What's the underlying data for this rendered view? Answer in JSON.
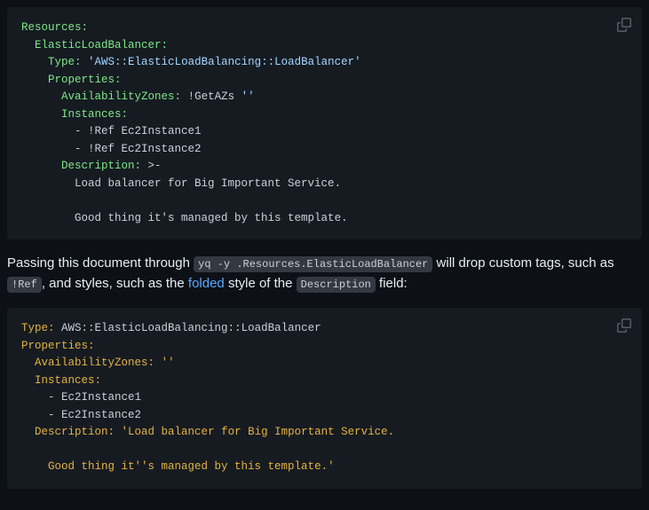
{
  "code1": {
    "l1_key": "Resources:",
    "l2_key": "ElasticLoadBalancer:",
    "l3_key": "Type:",
    "l3_val": "'AWS::ElasticLoadBalancing::LoadBalancer'",
    "l4_key": "Properties:",
    "l5_key": "AvailabilityZones:",
    "l5_tag": "!GetAZs",
    "l5_val": "''",
    "l6_key": "Instances:",
    "l7_tag": "!Ref",
    "l7_val": "Ec2Instance1",
    "l8_tag": "!Ref",
    "l8_val": "Ec2Instance2",
    "l9_key": "Description:",
    "l9_op": ">-",
    "l10": "Load balancer for Big Important Service.",
    "l11": "",
    "l12": "Good thing it's managed by this template."
  },
  "para": {
    "t1": "Passing this document through ",
    "cmd": "yq -y .Resources.ElasticLoadBalancer",
    "t2": " will drop custom tags, such as ",
    "ref": "!Ref",
    "t3": ", and styles, such as the ",
    "link": "folded",
    "t4": " style of the ",
    "desc": "Description",
    "t5": " field:"
  },
  "code2": {
    "l1_key": "Type:",
    "l1_val": "AWS::ElasticLoadBalancing::LoadBalancer",
    "l2_key": "Properties:",
    "l3_key": "AvailabilityZones:",
    "l3_val": "''",
    "l4_key": "Instances:",
    "l5_val": "Ec2Instance1",
    "l6_val": "Ec2Instance2",
    "l7_key": "Description:",
    "l7_str_a": "'Load balancer for Big Important Service.",
    "l8": "",
    "l9_a": "    Good thing it'",
    "l9_b": "'s managed by this template.'"
  },
  "icons": {
    "copy": "copy-icon"
  }
}
